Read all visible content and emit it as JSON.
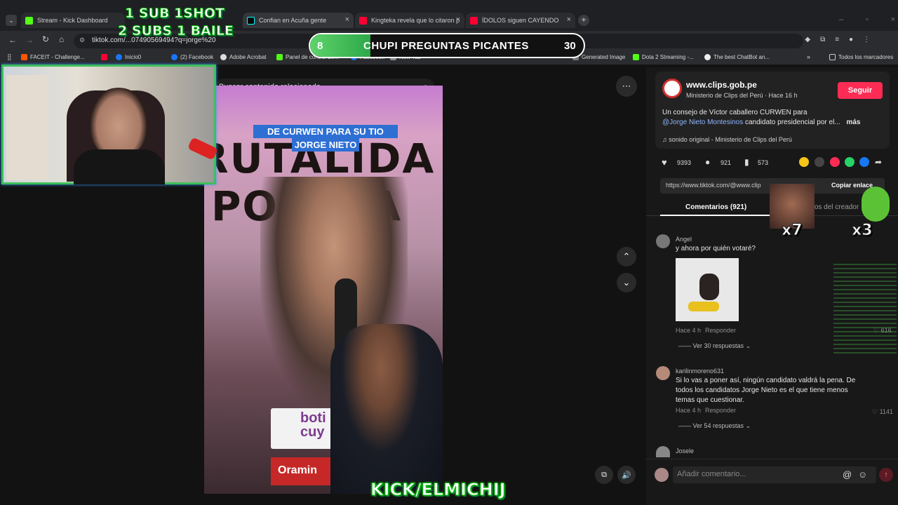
{
  "tabs": [
    {
      "label": "Stream - Kick Dashboard",
      "color": "#53fc18"
    },
    {
      "label": "Confian en Acuña gente",
      "color": "#ffffff"
    },
    {
      "label": "Kingteka revela que lo citaron p",
      "color": "#ff0033"
    },
    {
      "label": "ÍDOLOS siguen CAYENDO",
      "color": "#ff0033"
    }
  ],
  "address": {
    "url": "tiktok.com/...07490569494?q=jorge%20"
  },
  "bookmarks": [
    "FACEIT - Challenge...",
    "Inicio0",
    "(2) Facebook",
    "Adobe Acrobat",
    "Panel de control de...",
    "Facebook",
    "New Tab",
    "Generated Image",
    "Dota 2 Streaming -...",
    "The best ChatBot an...",
    "Todos los marcadores"
  ],
  "overlay": {
    "sub_line1": "1 SUB 1SHOT",
    "sub_line2": "2 SUBS 1 BAILE",
    "poll_left": "8",
    "poll_title": "CHUPI PREGUNTAS PICANTES",
    "poll_right": "30",
    "bottom_tag": "KICK/ELMICHIJ",
    "x7": "x7",
    "x3": "x3"
  },
  "search": {
    "placeholder": "Buscar contenido relacionado"
  },
  "video": {
    "caption_line1": "DE CURWEN PARA SU TIO",
    "caption_line2": "JORGE NIETO",
    "bg_text1": "RUTALIDA",
    "bg_text2": "POLÍ  CA",
    "brand1": "boti",
    "brand2": "cuy",
    "brand3": "Oramin"
  },
  "author": {
    "name": "www.clips.gob.pe",
    "subtitle": "Ministerio de Clips del Perú · Hace 16 h",
    "follow": "Seguir",
    "description": "Un consejo de Víctor caballero CURWEN para",
    "mention": "@Jorge Nieto Montesinos",
    "description_rest": " candidato presidencial por el...",
    "more": "más",
    "sound": "sonido original - Ministerio de Clips del Perú"
  },
  "stats": {
    "likes": "9393",
    "comments": "921",
    "saves": "573"
  },
  "share": {
    "link": "https://www.tiktok.com/@www.clip",
    "copy": "Copiar enlace"
  },
  "comment_tabs": {
    "comments": "Comentarios (921)",
    "creator": "Videos del creador"
  },
  "comments": [
    {
      "name": "Angel",
      "text": "y ahora por quién votaré?",
      "time": "Hace 4 h",
      "reply": "Responder",
      "likes": "616",
      "replies": "Ver 30 respuestas"
    },
    {
      "name": "karilinmoreno631",
      "text": "Si lo vas a poner así, ningún candidato valdrá la pena. De todos los candidatos Jorge Nieto es el que tiene menos temas que cuestionar.",
      "time": "Hace 4 h",
      "reply": "Responder",
      "likes": "1141",
      "replies": "Ver 54 respuestas"
    },
    {
      "name": "Josele"
    }
  ],
  "add_comment": {
    "placeholder": "Añadir comentario..."
  }
}
